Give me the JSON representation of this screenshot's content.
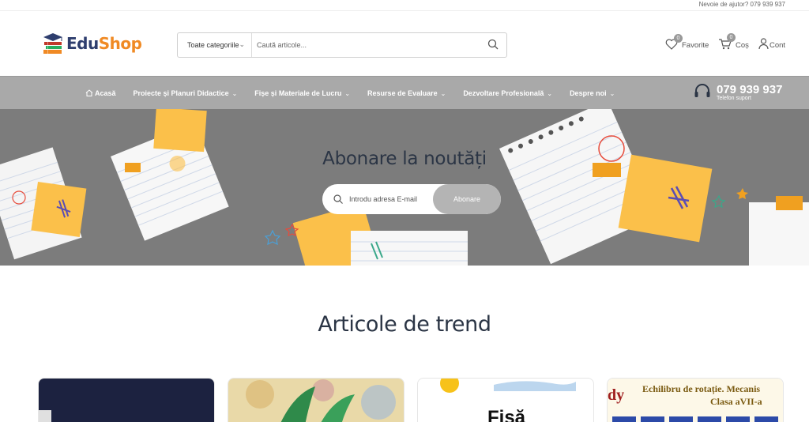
{
  "topbar": {
    "help_text": "Nevoie de ajutor? 079 939 937"
  },
  "header": {
    "logo": {
      "part1": "Edu",
      "part2": "Shop"
    },
    "search": {
      "category_label": "Toate categoriile",
      "placeholder": "Caută articole..."
    },
    "favorites": {
      "label": "Favorite",
      "count": "0"
    },
    "cart": {
      "label": "Coș",
      "count": "0"
    },
    "account": {
      "label": "Cont"
    }
  },
  "nav": {
    "items": [
      {
        "label": "Acasă",
        "dropdown": false
      },
      {
        "label": "Proiecte și Planuri Didactice",
        "dropdown": true
      },
      {
        "label": "Fișe și Materiale de Lucru",
        "dropdown": true
      },
      {
        "label": "Resurse de Evaluare",
        "dropdown": true
      },
      {
        "label": "Dezvoltare Profesională",
        "dropdown": true
      },
      {
        "label": "Despre noi",
        "dropdown": true
      }
    ],
    "phone": {
      "number": "079 939 937",
      "label": "Telefon suport"
    }
  },
  "hero": {
    "title": "Abonare la noutăți",
    "email_placeholder": "Introdu adresa E-mail",
    "button": "Abonare"
  },
  "trending": {
    "title": "Articole de trend",
    "cards": [
      {
        "text": ""
      },
      {
        "text": ""
      },
      {
        "text": "Fișă"
      },
      {
        "heading": "Echilibru de rotație. Mecanis",
        "sub": "Clasa aVII-a",
        "mark": "dy"
      }
    ]
  },
  "colors": {
    "nav_bg": "#a9a9a9",
    "hero_bg": "#7c7c7c",
    "logo_blue": "#2e3e6e",
    "logo_orange": "#f08a24",
    "sticky_note": "#fbc04a"
  }
}
